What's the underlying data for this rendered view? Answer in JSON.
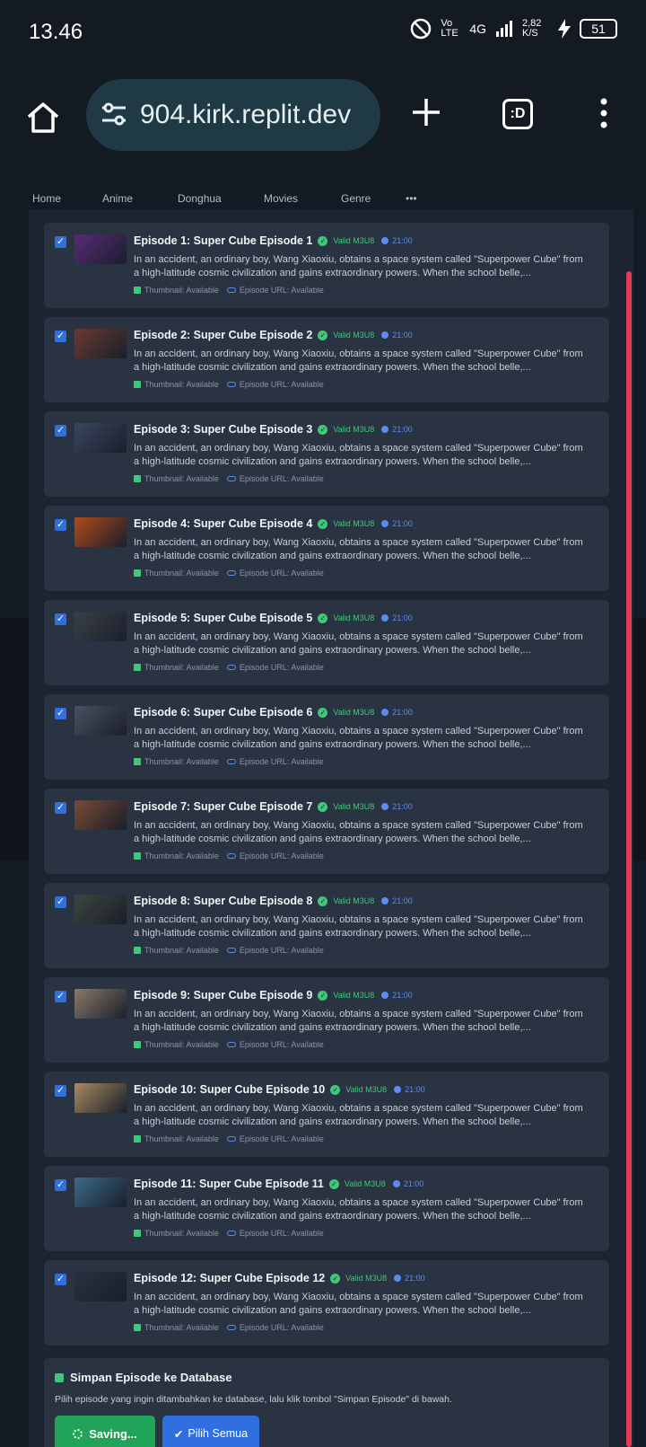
{
  "status": {
    "time": "13.46",
    "net": "4G",
    "speed": "2,82 K/S",
    "battery": "51",
    "volte": "Vo LTE"
  },
  "browser": {
    "url": "904.kirk.replit.dev",
    "tabs_label": ":D"
  },
  "site_nav": [
    "Home",
    "Anime",
    "Donghua",
    "Movies",
    "Genre",
    "•••"
  ],
  "episode_common": {
    "valid_label": "Valid M3U8",
    "duration": "21:00",
    "description": "In an accident, an ordinary boy, Wang Xiaoxiu, obtains a space system called \"Superpower Cube\" from a high-latitude cosmic civilization and gains extraordinary powers. When the school belle,...",
    "thumb_label": "Thumbnail: Available",
    "url_label": "Episode URL: Available"
  },
  "episodes": [
    {
      "title": "Episode 1: Super Cube Episode 1",
      "color": "#5a2a7a"
    },
    {
      "title": "Episode 2: Super Cube Episode 2",
      "color": "#6b3a30"
    },
    {
      "title": "Episode 3: Super Cube Episode 3",
      "color": "#3a4560"
    },
    {
      "title": "Episode 4: Super Cube Episode 4",
      "color": "#b04a1a"
    },
    {
      "title": "Episode 5: Super Cube Episode 5",
      "color": "#3b4048"
    },
    {
      "title": "Episode 6: Super Cube Episode 6",
      "color": "#4a5060"
    },
    {
      "title": "Episode 7: Super Cube Episode 7",
      "color": "#7a4a35"
    },
    {
      "title": "Episode 8: Super Cube Episode 8",
      "color": "#3e4540"
    },
    {
      "title": "Episode 9: Super Cube Episode 9",
      "color": "#8a7a68"
    },
    {
      "title": "Episode 10: Super Cube Episode 10",
      "color": "#a88a60"
    },
    {
      "title": "Episode 11: Super Cube Episode 11",
      "color": "#3a6a88"
    },
    {
      "title": "Episode 12: Super Cube Episode 12",
      "color": "#2a3040"
    }
  ],
  "save_panel": {
    "title": "Simpan Episode ke Database",
    "subtitle": "Pilih episode yang ingin ditambahkan ke database, lalu klik tombol \"Simpan Episode\" di bawah.",
    "save_button": "Saving...",
    "select_all_button": "Pilih Semua"
  }
}
